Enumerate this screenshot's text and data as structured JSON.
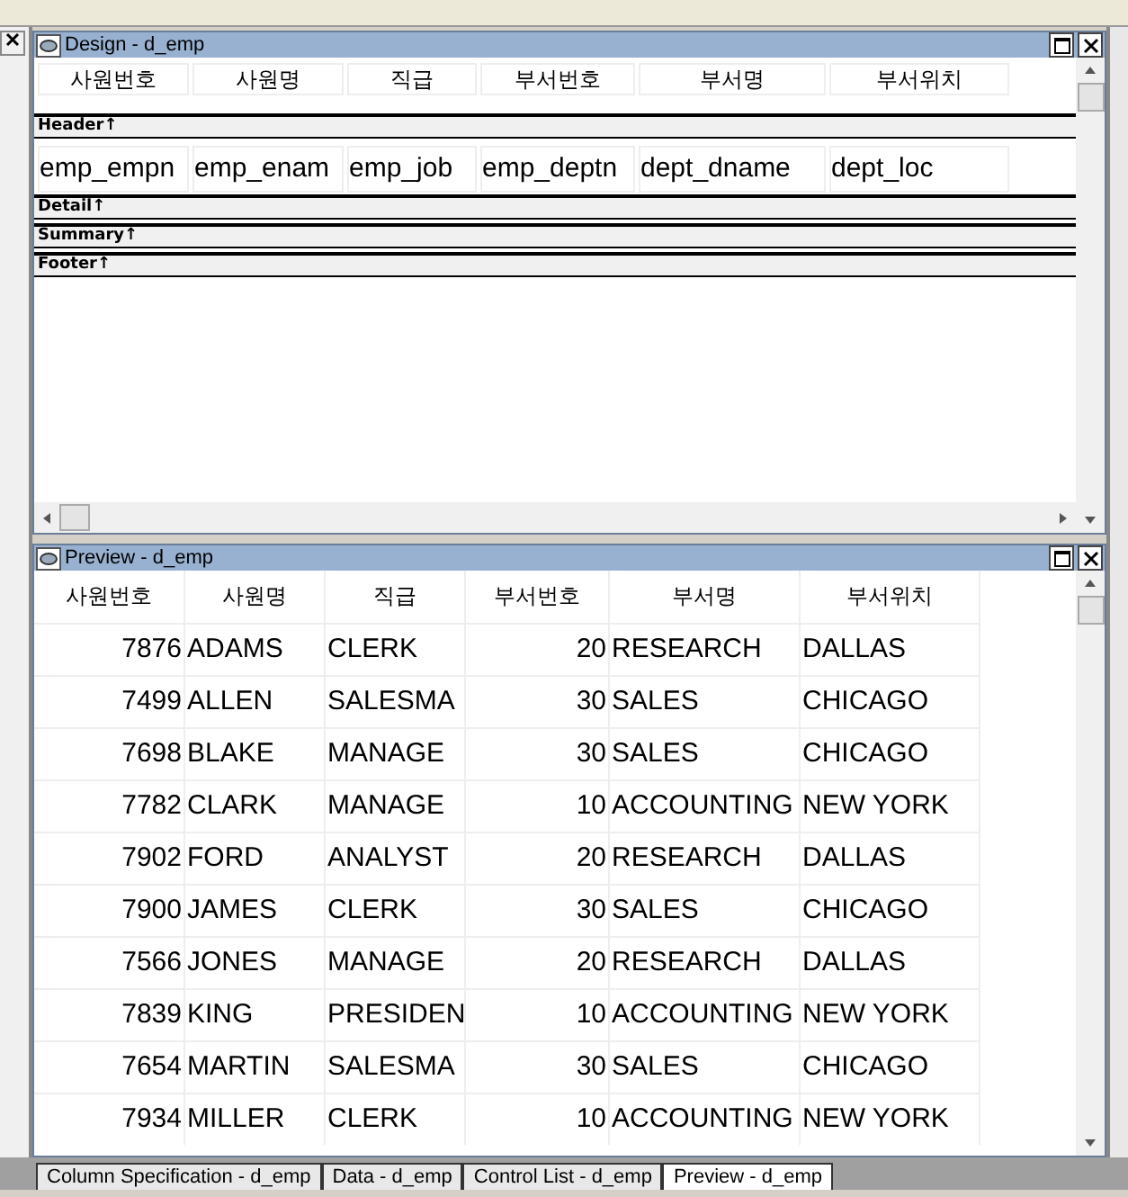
{
  "design": {
    "title": "Design - d_emp",
    "columns": [
      "사원번호",
      "사원명",
      "직급",
      "부서번호",
      "부서명",
      "부서위치"
    ],
    "bands": [
      {
        "label": "Header↑",
        "fields": [
          "emp_empn",
          "emp_enam",
          "emp_job",
          "emp_deptn",
          "dept_dname",
          "dept_loc"
        ]
      },
      {
        "label": "Detail↑"
      },
      {
        "label": "Summary↑"
      },
      {
        "label": "Footer↑"
      }
    ]
  },
  "preview": {
    "title": "Preview - d_emp",
    "columns": [
      "사원번호",
      "사원명",
      "직급",
      "부서번호",
      "부서명",
      "부서위치"
    ],
    "rows": [
      [
        "7876",
        "ADAMS",
        "CLERK",
        "20",
        "RESEARCH",
        "DALLAS"
      ],
      [
        "7499",
        "ALLEN",
        "SALESMA",
        "30",
        "SALES",
        "CHICAGO"
      ],
      [
        "7698",
        "BLAKE",
        "MANAGE",
        "30",
        "SALES",
        "CHICAGO"
      ],
      [
        "7782",
        "CLARK",
        "MANAGE",
        "10",
        "ACCOUNTING",
        "NEW YORK"
      ],
      [
        "7902",
        "FORD",
        "ANALYST",
        "20",
        "RESEARCH",
        "DALLAS"
      ],
      [
        "7900",
        "JAMES",
        "CLERK",
        "30",
        "SALES",
        "CHICAGO"
      ],
      [
        "7566",
        "JONES",
        "MANAGE",
        "20",
        "RESEARCH",
        "DALLAS"
      ],
      [
        "7839",
        "KING",
        "PRESIDEN",
        "10",
        "ACCOUNTING",
        "NEW YORK"
      ],
      [
        "7654",
        "MARTIN",
        "SALESMA",
        "30",
        "SALES",
        "CHICAGO"
      ],
      [
        "7934",
        "MILLER",
        "CLERK",
        "10",
        "ACCOUNTING",
        "NEW YORK"
      ]
    ]
  },
  "tabs": [
    {
      "label": "Column Specification - d_emp",
      "selected": false
    },
    {
      "label": "Data - d_emp",
      "selected": false
    },
    {
      "label": "Control List - d_emp",
      "selected": false
    },
    {
      "label": "Preview - d_emp",
      "selected": true
    }
  ]
}
